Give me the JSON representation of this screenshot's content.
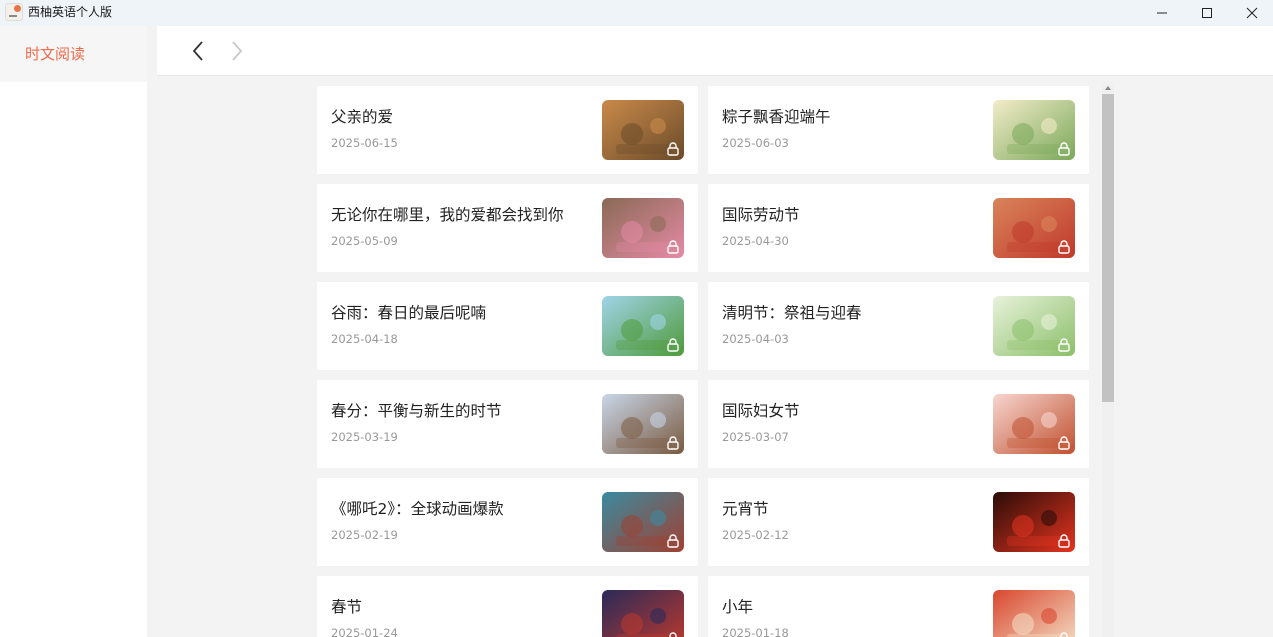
{
  "window": {
    "title": "西柚英语个人版",
    "icon": "app-logo-icon",
    "controls": [
      "minimize-icon",
      "maximize-icon",
      "close-icon"
    ]
  },
  "sidebar": {
    "items": [
      {
        "label": "时文阅读",
        "active": true,
        "color": "#f0694a"
      }
    ]
  },
  "nav": {
    "back_icon": "chevron-left-icon",
    "forward_icon": "chevron-right-icon",
    "forward_enabled": false
  },
  "articles": [
    {
      "title": "父亲的爱",
      "date": "2025-06-15",
      "thumb_colors": [
        "#c98a4a",
        "#6b4b2a"
      ],
      "locked": true
    },
    {
      "title": "粽子飘香迎端午",
      "date": "2025-06-03",
      "thumb_colors": [
        "#f3ecc9",
        "#7aa85a"
      ],
      "locked": true
    },
    {
      "title": "无论你在哪里，我的爱都会找到你",
      "date": "2025-05-09",
      "thumb_colors": [
        "#8a6a55",
        "#e58aa5"
      ],
      "locked": true
    },
    {
      "title": "国际劳动节",
      "date": "2025-04-30",
      "thumb_colors": [
        "#d9845a",
        "#c0392b"
      ],
      "locked": true
    },
    {
      "title": "谷雨：春日的最后呢喃",
      "date": "2025-04-18",
      "thumb_colors": [
        "#9fd4e8",
        "#4f9a3a"
      ],
      "locked": true
    },
    {
      "title": "清明节：祭祖与迎春",
      "date": "2025-04-03",
      "thumb_colors": [
        "#e8f2da",
        "#8bbf6a"
      ],
      "locked": true
    },
    {
      "title": "春分：平衡与新生的时节",
      "date": "2025-03-19",
      "thumb_colors": [
        "#c8d6e8",
        "#7a5a40"
      ],
      "locked": true
    },
    {
      "title": "国际妇女节",
      "date": "2025-03-07",
      "thumb_colors": [
        "#f7d6cf",
        "#c0502f"
      ],
      "locked": true
    },
    {
      "title": "《哪吒2》：全球动画爆款",
      "date": "2025-02-19",
      "thumb_colors": [
        "#3a8aa0",
        "#a04030"
      ],
      "locked": true
    },
    {
      "title": "元宵节",
      "date": "2025-02-12",
      "thumb_colors": [
        "#2a0d08",
        "#e5331f"
      ],
      "locked": true
    },
    {
      "title": "春节",
      "date": "2025-01-24",
      "thumb_colors": [
        "#2a2a5a",
        "#c0392b"
      ],
      "locked": true
    },
    {
      "title": "小年",
      "date": "2025-01-18",
      "thumb_colors": [
        "#d9472f",
        "#f4e2c8"
      ],
      "locked": true
    }
  ]
}
